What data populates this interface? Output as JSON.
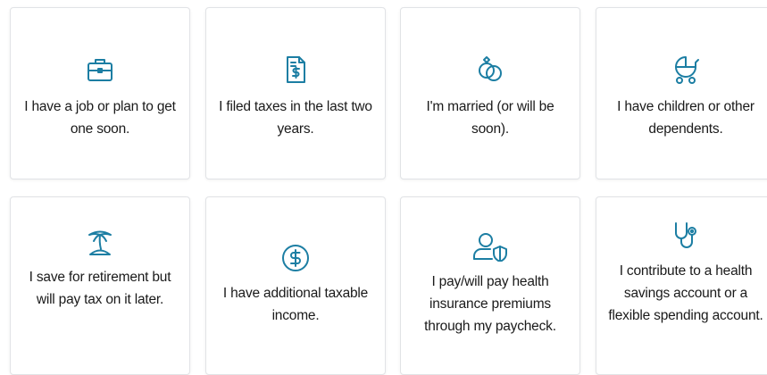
{
  "accent_color": "#1c7ea3",
  "cards": [
    {
      "icon": "briefcase-icon",
      "label": "I have a job or plan to get one soon."
    },
    {
      "icon": "tax-document-icon",
      "label": "I filed taxes in the last two years."
    },
    {
      "icon": "wedding-rings-icon",
      "label": "I'm married (or will be soon)."
    },
    {
      "icon": "baby-stroller-icon",
      "label": "I have children or other dependents."
    },
    {
      "icon": "palm-tree-island-icon",
      "label": "I save for retirement but will pay tax on it later."
    },
    {
      "icon": "dollar-coin-icon",
      "label": "I have additional taxable income."
    },
    {
      "icon": "user-shield-icon",
      "label": "I pay/will pay health insurance premiums through my paycheck."
    },
    {
      "icon": "stethoscope-icon",
      "label": "I contribute to a health savings account or a flexible spending account."
    }
  ]
}
